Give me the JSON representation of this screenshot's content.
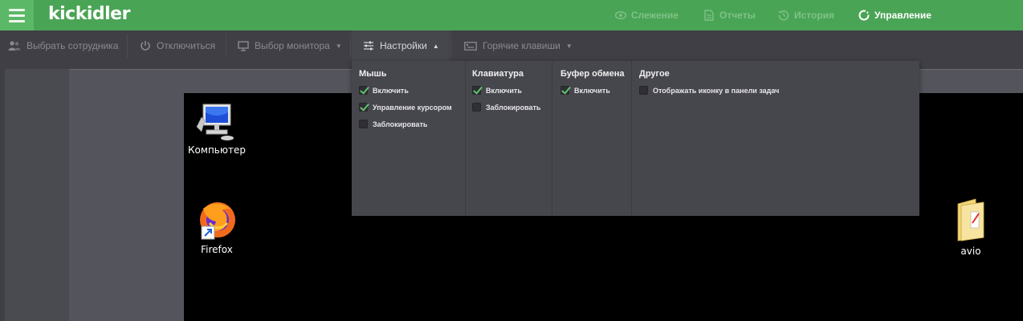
{
  "header": {
    "logo": "kickidler",
    "nav": [
      {
        "label": "Слежение",
        "icon": "eye-icon"
      },
      {
        "label": "Отчеты",
        "icon": "document-icon"
      },
      {
        "label": "История",
        "icon": "history-icon"
      },
      {
        "label": "Управление",
        "icon": "control-icon",
        "active": true
      }
    ]
  },
  "toolbar": {
    "select_employee": "Выбрать сотрудника",
    "disconnect": "Отключиться",
    "monitor_select": "Выбор монитора",
    "settings": "Настройки",
    "hotkeys": "Горячие клавиши"
  },
  "settings": {
    "mouse": {
      "title": "Мышь",
      "options": [
        {
          "label": "Включить",
          "checked": true
        },
        {
          "label": "Управление курсором",
          "checked": true
        },
        {
          "label": "Заблокировать",
          "checked": false
        }
      ]
    },
    "keyboard": {
      "title": "Клавиатура",
      "options": [
        {
          "label": "Включить",
          "checked": true
        },
        {
          "label": "Заблокировать",
          "checked": false
        }
      ]
    },
    "clipboard": {
      "title": "Буфер обмена",
      "options": [
        {
          "label": "Включить",
          "checked": true
        }
      ]
    },
    "other": {
      "title": "Другое",
      "options": [
        {
          "label": "Отображать иконку в панели задач",
          "checked": false
        }
      ]
    }
  },
  "desktop": {
    "icons": [
      {
        "label": "Компьютер",
        "icon": "computer-icon"
      },
      {
        "label": "Firefox",
        "icon": "firefox-icon"
      },
      {
        "label": "avio",
        "icon": "folder-icon"
      }
    ]
  },
  "colors": {
    "header_green": "#4aa455",
    "check_green": "#5fc26b",
    "panel_dark": "#46464d"
  }
}
